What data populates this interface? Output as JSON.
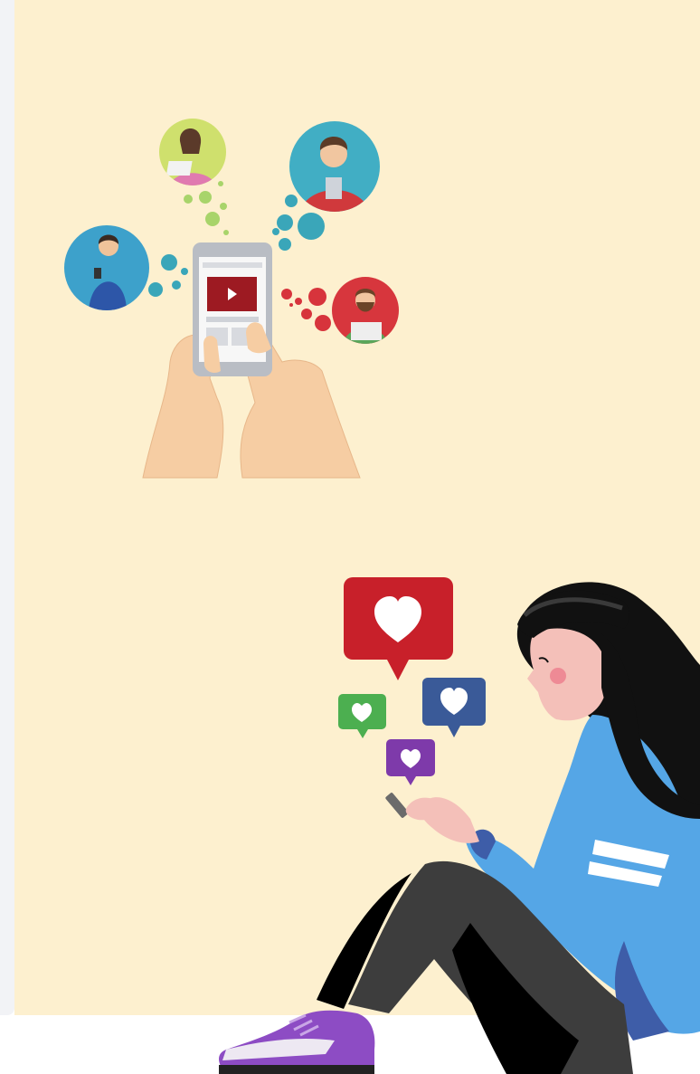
{
  "colors": {
    "panel_background": "#fdf0cf",
    "side_rail": "#f2f3f6",
    "page_background": "#ffffff",
    "like_red": "#c8202a",
    "like_blue": "#3a5a98",
    "like_green": "#4caf50",
    "like_purple": "#7e3aaa",
    "sweater_blue": "#55a6e6",
    "hair_black": "#111111",
    "pants_grey": "#3d3d3d",
    "shoe_purple": "#8d4cc4"
  },
  "icons": {
    "top_illustration": "social-network-phone-illustration",
    "bottom_illustration": "girl-with-phone-likes-illustration",
    "heart": "heart-icon"
  }
}
